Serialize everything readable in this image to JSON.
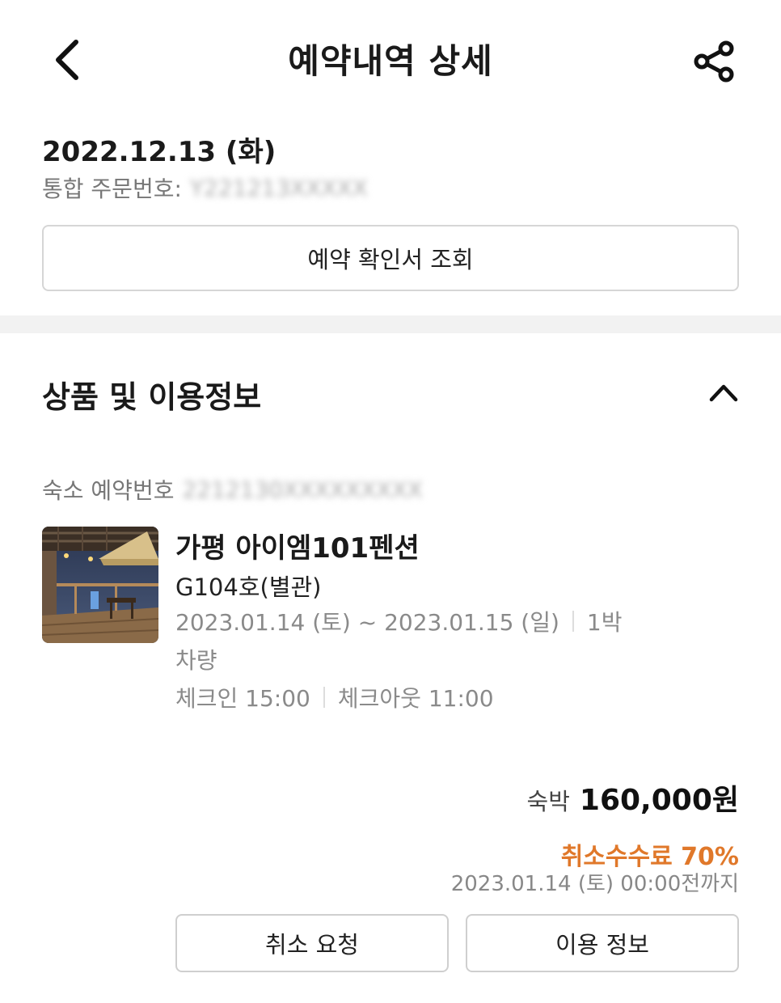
{
  "header": {
    "title": "예약내역 상세",
    "back_icon": "chevron-left-icon",
    "share_icon": "share-icon"
  },
  "order": {
    "date": "2022.12.13 (화)",
    "number_label": "통합 주문번호:",
    "number_value": "Y221213XXXXX",
    "confirm_button": "예약 확인서 조회"
  },
  "product_section": {
    "title": "상품 및 이용정보",
    "collapse_icon": "chevron-up-icon",
    "reservation_label": "숙소 예약번호",
    "reservation_value": "2212130XXXXXXXXX",
    "property_name": "가평 아이엠101펜션",
    "room_name": "G104호(별관)",
    "date_range": "2023.01.14 (토) ~ 2023.01.15 (일)",
    "nights": "1박",
    "vehicle": "차량",
    "checkin": "체크인 15:00",
    "checkout": "체크아웃 11:00"
  },
  "price": {
    "label": "숙박",
    "value": "160,000원"
  },
  "cancellation": {
    "fee": "취소수수료 70%",
    "deadline": "2023.01.14 (토) 00:00전까지",
    "cancel_button": "취소 요청",
    "info_button": "이용 정보"
  },
  "colors": {
    "accent": "#e0782a",
    "divider": "#f2f2f2",
    "border": "#d6d6d6"
  }
}
